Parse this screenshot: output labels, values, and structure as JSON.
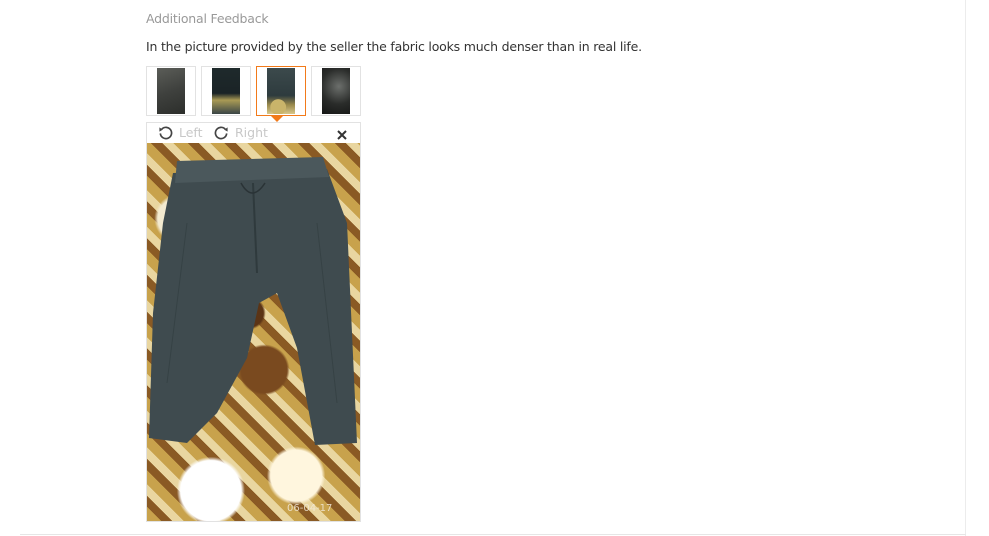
{
  "feedback": {
    "title": "Additional Feedback",
    "text": "In the picture provided by the seller the fabric looks much denser than in real life."
  },
  "thumbnails": [
    {
      "name": "photo-1",
      "selected": false
    },
    {
      "name": "photo-2",
      "selected": false
    },
    {
      "name": "photo-3",
      "selected": true
    },
    {
      "name": "photo-4",
      "selected": false
    }
  ],
  "viewer": {
    "rotate_left_label": "Left",
    "rotate_right_label": "Right",
    "close_icon": "close-icon",
    "photo_stamp": "06-04-17",
    "colors": {
      "accent": "#f27a1a",
      "muted_text": "#c8c8c8"
    }
  }
}
